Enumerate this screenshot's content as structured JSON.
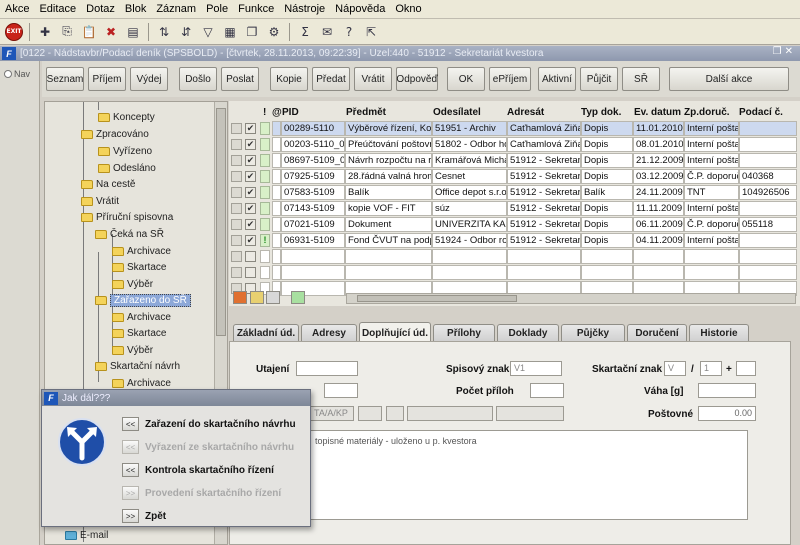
{
  "menu": [
    "Akce",
    "Editace",
    "Dotaz",
    "Blok",
    "Záznam",
    "Pole",
    "Funkce",
    "Nástroje",
    "Nápověda",
    "Okno"
  ],
  "toolbar": {
    "exit_label": "EXIT",
    "icons": [
      "exit-icon",
      "new-record-icon",
      "copy-icon",
      "paste-icon",
      "delete-icon",
      "print-icon",
      "sort-asc-icon",
      "sort-desc-icon",
      "filter-icon",
      "calendar-icon",
      "documents-icon",
      "gear-icon",
      "sum-icon",
      "mail-icon",
      "help-icon",
      "pointer-help-icon"
    ]
  },
  "window": {
    "title": "[0122 - Nádstavbr/Podací deník (SPSBOLD) - [čtvrtek, 28.11.2013, 09:22:39] - Uzel:440 - 51912 - Sekretariát kvestora"
  },
  "nav_label": "Nav",
  "action_buttons": [
    "Seznam",
    "Příjem",
    "Výdej",
    "Došlo",
    "Poslat",
    "Kopie",
    "Předat",
    "Vrátit",
    "Odpověď",
    "OK",
    "ePříjem",
    "Aktivní",
    "Půjčit",
    "SŘ",
    "Další akce"
  ],
  "tree": [
    {
      "label": "Koncepty",
      "level": 3
    },
    {
      "label": "Zpracováno",
      "level": 2
    },
    {
      "label": "Vyřízeno",
      "level": 3
    },
    {
      "label": "Odesláno",
      "level": 3
    },
    {
      "label": "Na cestě",
      "level": 2
    },
    {
      "label": "Vrátit",
      "level": 2
    },
    {
      "label": "Příruční spisovna",
      "level": 2
    },
    {
      "label": "Čeká na SŘ",
      "level": 3
    },
    {
      "label": "Archivace",
      "level": 4
    },
    {
      "label": "Skartace",
      "level": 4
    },
    {
      "label": "Výběr",
      "level": 4
    },
    {
      "label": "Zařazeno do SŘ",
      "level": 3,
      "selected": true
    },
    {
      "label": "Archivace",
      "level": 4
    },
    {
      "label": "Skartace",
      "level": 4
    },
    {
      "label": "Výběr",
      "level": 4
    },
    {
      "label": "Skartační návrh",
      "level": 3
    },
    {
      "label": "Archivace",
      "level": 4
    }
  ],
  "tree_bottom_item": "E-mail",
  "grid": {
    "headers": {
      "excl": "!",
      "attach": "@",
      "pid": "PID",
      "predmet": "Předmět",
      "odesilatel": "Odesílatel",
      "adresat": "Adresát",
      "typ": "Typ dok.",
      "datum": "Ev. datum",
      "zp": "Zp.doruč.",
      "podaci": "Podací č."
    },
    "rows": [
      {
        "pid": "00289-5110",
        "predmet": "Výběrové řízení, Kouc",
        "odesilatel": "51951 - Archiv",
        "adresat": "Caťhamlová Ziňa",
        "typ": "Dopis",
        "datum": "11.01.2010",
        "zp": "Interní pošta",
        "podaci": "",
        "flag": "",
        "selected": true
      },
      {
        "pid": "00203-5110_00",
        "predmet": "Přeúčtování poštovnic",
        "odesilatel": "51802 - Odbor hos",
        "adresat": "Caťhamlová Ziňa",
        "typ": "Dopis",
        "datum": "08.01.2010",
        "zp": "Interní pošta",
        "podaci": "",
        "flag": ""
      },
      {
        "pid": "08697-5109_00",
        "predmet": "Návrh rozpočtu na rok",
        "odesilatel": "Kramářová Michae",
        "adresat": "51912 - Sekretariá",
        "typ": "Dopis",
        "datum": "21.12.2009",
        "zp": "Interní pošta",
        "podaci": "",
        "flag": ""
      },
      {
        "pid": "07925-5109",
        "predmet": "28.řádná valná hroma",
        "odesilatel": "Cesnet",
        "adresat": "51912 - Sekretariá",
        "typ": "Dopis",
        "datum": "03.12.2009",
        "zp": "Č.P. doporuče",
        "podaci": "040368",
        "flag": ""
      },
      {
        "pid": "07583-5109",
        "predmet": "Balík",
        "odesilatel": "Office depot s.r.o.",
        "adresat": "51912 - Sekretariá",
        "typ": "Balík",
        "datum": "24.11.2009",
        "zp": "TNT",
        "podaci": "104926506",
        "flag": ""
      },
      {
        "pid": "07143-5109",
        "predmet": "kopie VOF - FIT",
        "odesilatel": "súz",
        "adresat": "51912 - Sekretariá",
        "typ": "Dopis",
        "datum": "11.11.2009",
        "zp": "Interní pošta",
        "podaci": "",
        "flag": ""
      },
      {
        "pid": "07021-5109",
        "predmet": "Dokument",
        "odesilatel": "UNIVERZITA KARL",
        "adresat": "51912 - Sekretariá",
        "typ": "Dopis",
        "datum": "06.11.2009",
        "zp": "Č.P. doporuče",
        "podaci": "055118",
        "flag": ""
      },
      {
        "pid": "06931-5109",
        "predmet": "Fond ČVUT na podpor",
        "odesilatel": "51924 - Odbor roz",
        "adresat": "51912 - Sekretariá",
        "typ": "Dopis",
        "datum": "04.11.2009",
        "zp": "Interní pošta",
        "podaci": "",
        "flag": "!"
      }
    ]
  },
  "tabs": [
    "Základní úd.",
    "Adresy",
    "Doplňující úd.",
    "Přílohy",
    "Doklady",
    "Půjčky",
    "Doručení",
    "Historie"
  ],
  "active_tab": "Doplňující úd.",
  "detail": {
    "utajeni_label": "Utajení",
    "spisovy_znak_label": "Spisový znak",
    "spisovy_znak_value": "V1",
    "skartacni_znak_label": "Skartační znak",
    "skartacni_znak_value": "V",
    "skartacni_lhuta": "1",
    "skartacni_separator": "/",
    "skartacni_plus": "+",
    "pocet_priloh_label": "Počet příloh",
    "vaha_label": "Váha [g]",
    "postovne_label": "Poštovné",
    "postovne_value": "0.00",
    "partial_field": "TA/A/KP",
    "note": "topisné materiály - uloženo u p. kvestora"
  },
  "dialog": {
    "title": "Jak dál???",
    "options": [
      {
        "btn": "<<",
        "label": "Zařazení do skartačního návrhu",
        "enabled": true
      },
      {
        "btn": "<<",
        "label": "Vyřazení ze skartačního návrhu",
        "enabled": false
      },
      {
        "btn": "<<",
        "label": "Kontrola skartačního řízení",
        "enabled": true
      },
      {
        "btn": ">>",
        "label": "Provedení skartačního řízení",
        "enabled": false
      },
      {
        "btn": ">>",
        "label": "Zpět",
        "enabled": true
      }
    ]
  }
}
